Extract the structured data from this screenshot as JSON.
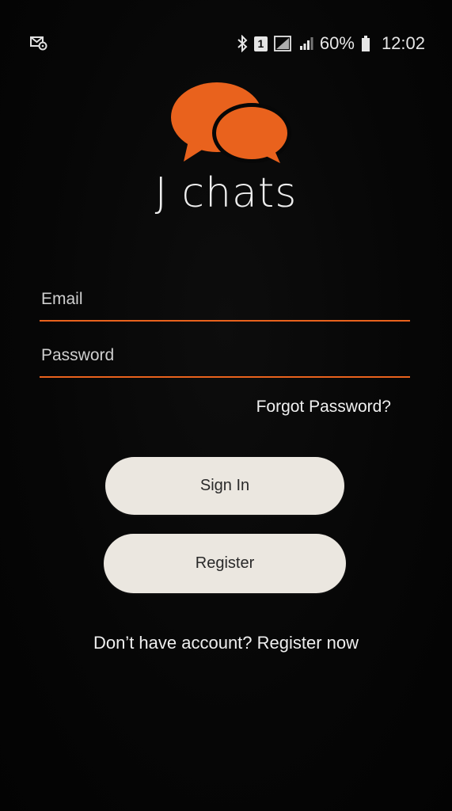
{
  "status_bar": {
    "notification_icon": "mail-settings-icon",
    "bluetooth_icon": "bluetooth-icon",
    "sim_label": "1",
    "signal_icon": "signal-icon",
    "battery": "60%",
    "battery_icon": "battery-icon",
    "time": "12:02"
  },
  "brand": {
    "logo_icon": "chat-bubbles-icon",
    "title": "J chats",
    "accent_color": "#e9621d"
  },
  "form": {
    "email_placeholder": "Email",
    "email_value": "",
    "password_placeholder": "Password",
    "password_value": "",
    "forgot_label": "Forgot Password?",
    "signin_label": "Sign In",
    "register_label": "Register",
    "register_now_label": "Don’t have account? Register now"
  }
}
